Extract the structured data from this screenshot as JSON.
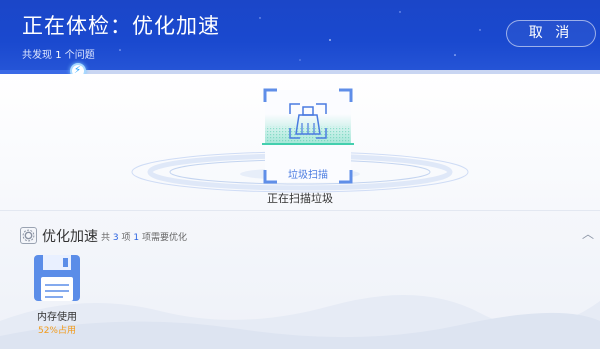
{
  "header": {
    "title": "正在体检：优化加速",
    "found_prefix": "共发现",
    "found_count": "1",
    "found_suffix": "个问题",
    "cancel_label": "取 消"
  },
  "progress": {
    "percent": 13
  },
  "scan": {
    "icon_label": "垃圾扫描",
    "status": "正在扫描垃圾"
  },
  "section": {
    "title": "优化加速",
    "sub_prefix": "共",
    "total": "3",
    "sub_mid": "项",
    "need": "1",
    "sub_suffix": "项需要优化"
  },
  "items": [
    {
      "label": "内存使用",
      "usage": "52%占用"
    }
  ],
  "colors": {
    "accent": "#1a49cf",
    "warning": "#f29b1b",
    "scan_green": "#5fd5b8"
  }
}
